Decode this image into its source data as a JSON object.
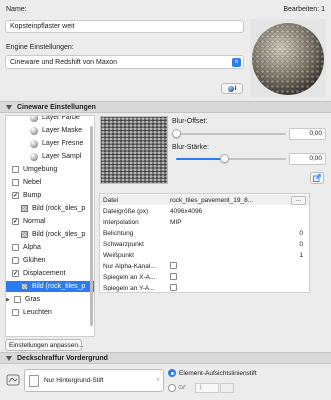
{
  "header": {
    "name_label": "Name:",
    "edit_label": "Bearbeiten: 1",
    "name_value": "Kopsteinpflaster weit",
    "engine_label": "Engine Einstellungen:",
    "engine_value": "Cineware und Redshift von Maxon",
    "info_badge": "i"
  },
  "cineware_section": {
    "title": "Cineware Einstellungen"
  },
  "tree": [
    {
      "label": "Layer Farbe",
      "kind": "sphere",
      "indent": 2
    },
    {
      "label": "Layer Maske",
      "kind": "sphere",
      "indent": 2
    },
    {
      "label": "Layer Fresne",
      "kind": "sphere",
      "indent": 2
    },
    {
      "label": "Layer Sampl",
      "kind": "sphere",
      "indent": 2
    },
    {
      "label": "Umgebung",
      "kind": "check",
      "checked": false,
      "indent": 0
    },
    {
      "label": "Nebel",
      "kind": "check",
      "checked": false,
      "indent": 0
    },
    {
      "label": "Bump",
      "kind": "check",
      "checked": true,
      "indent": 0,
      "expanded": true
    },
    {
      "label": "Bild (rock_tiles_p",
      "kind": "texture",
      "indent": 1
    },
    {
      "label": "Normal",
      "kind": "check",
      "checked": true,
      "indent": 0,
      "expanded": true
    },
    {
      "label": "Bild (rock_tiles_p",
      "kind": "texture",
      "indent": 1
    },
    {
      "label": "Alpha",
      "kind": "check",
      "checked": false,
      "indent": 0
    },
    {
      "label": "Glühen",
      "kind": "check",
      "checked": false,
      "indent": 0
    },
    {
      "label": "Displacement",
      "kind": "check",
      "checked": true,
      "indent": 0,
      "expanded": true
    },
    {
      "label": "Bild (rock_tiles_p",
      "kind": "texture",
      "indent": 1,
      "selected": true
    },
    {
      "label": "Gras",
      "kind": "check",
      "checked": false,
      "indent": 0,
      "caret": true
    },
    {
      "label": "Leuchten",
      "kind": "check",
      "checked": false,
      "indent": 0
    }
  ],
  "tree_footer_button": "Einstellungen anpassen...",
  "blur": {
    "offset_label": "Blur-Offset:",
    "offset_value": "0,00",
    "offset_fraction": 0.0,
    "strength_label": "Blur-Stärke:",
    "strength_value": "0,00",
    "strength_fraction": 0.44
  },
  "properties": [
    {
      "key": "Datei",
      "value": "rock_tiles_pavement_19_8...",
      "has_button": true,
      "button": "..."
    },
    {
      "key": "Dateigröße (px)",
      "value": "4096x4096"
    },
    {
      "key": "Interpolation",
      "value": "MIP"
    },
    {
      "key": "Belichtung",
      "value": "0"
    },
    {
      "key": "Schwarzpunkt",
      "value": "0"
    },
    {
      "key": "Weißpunkt",
      "value": "1"
    },
    {
      "key": "Nur Alpha-Kanal...",
      "checkbox": true
    },
    {
      "key": "Spiegeln an X-A...",
      "checkbox": true
    },
    {
      "key": "Spiegeln an Y-A...",
      "checkbox": true
    }
  ],
  "deck_section": {
    "title": "Deckschraffur Vordergrund",
    "pen_value": "Nur Hintergrund-Stift",
    "radio1": "Element-Aufsichtslinienstift",
    "pen_number": "1"
  },
  "colors": {
    "accent": "#2c7bf2",
    "selection": "#2c7bf2"
  }
}
